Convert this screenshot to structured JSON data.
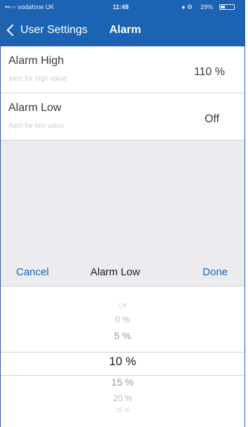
{
  "status_bar": {
    "carrier": "••◦◦◦ vodafone UK",
    "time": "11:48",
    "battery": "29%"
  },
  "nav": {
    "back_label": "User Settings",
    "title": "Alarm"
  },
  "rows": [
    {
      "title": "Alarm High",
      "subtitle": "Alert for high value",
      "value": "110 %"
    },
    {
      "title": "Alarm Low",
      "subtitle": "Alert for low value",
      "value": "Off"
    }
  ],
  "picker": {
    "cancel_label": "Cancel",
    "title": "Alarm Low",
    "done_label": "Done",
    "options": [
      "Off",
      "0 %",
      "5 %",
      "10 %",
      "15 %",
      "20 %",
      "25 %"
    ],
    "selected": "10 %"
  },
  "colors": {
    "accent": "#1d63b3",
    "link": "#1f65b8",
    "background": "#ebebf0"
  }
}
